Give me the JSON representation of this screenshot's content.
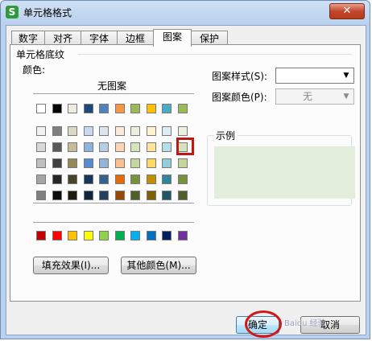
{
  "window": {
    "title": "单元格格式",
    "app_icon_letter": "S",
    "close_glyph": "✕"
  },
  "tabs": [
    {
      "label": "数字",
      "active": false
    },
    {
      "label": "对齐",
      "active": false
    },
    {
      "label": "字体",
      "active": false
    },
    {
      "label": "边框",
      "active": false
    },
    {
      "label": "图案",
      "active": true
    },
    {
      "label": "保护",
      "active": false
    }
  ],
  "shading": {
    "group_label": "单元格底纹",
    "color_label": "颜色:",
    "no_pattern_label": "无图案",
    "selected_color": "#e2eedb",
    "palette_rows": [
      [
        "#ffffff",
        "#000000",
        "#eeece1",
        "#1f497d",
        "#4f81bd",
        "#f79646",
        "#9bbb59",
        "#ffc000",
        "#4bacc6",
        "#9bbb59"
      ],
      [
        "#f2f2f2",
        "#7f7f7f",
        "#ddd9c3",
        "#c6d9f0",
        "#dbe5f1",
        "#fde9d9",
        "#ebf1dd",
        "#fff2cc",
        "#dbeef3",
        "#ebf1dd"
      ],
      [
        "#d8d8d8",
        "#595959",
        "#c4bd97",
        "#8db3e2",
        "#b8cce4",
        "#fbd5b5",
        "#d7e3bc",
        "#ffe599",
        "#b7dde8",
        "#d7e3bc"
      ],
      [
        "#bfbfbf",
        "#3f3f3f",
        "#938953",
        "#548dd4",
        "#95b3d7",
        "#fac08f",
        "#c3d69b",
        "#ffd966",
        "#92cddc",
        "#c3d69b"
      ],
      [
        "#a5a5a5",
        "#262626",
        "#494429",
        "#17365d",
        "#366092",
        "#e36c09",
        "#76923c",
        "#bf8f00",
        "#31859b",
        "#76923c"
      ],
      [
        "#7f7f7f",
        "#0c0c0c",
        "#1d1b10",
        "#0f243e",
        "#244061",
        "#974806",
        "#4f6128",
        "#7f6000",
        "#205867",
        "#4f6128"
      ]
    ],
    "standard_colors": [
      "#c00000",
      "#ff0000",
      "#ffc000",
      "#ffff00",
      "#92d050",
      "#00b050",
      "#00b0f0",
      "#0070c0",
      "#002060",
      "#7030a0"
    ],
    "fill_effects_button": "填充效果(I)...",
    "more_colors_button": "其他颜色(M)..."
  },
  "pattern": {
    "style_label": "图案样式(S):",
    "style_value": "",
    "color_label": "图案颜色(P):",
    "color_value": "无"
  },
  "preview": {
    "label": "示例"
  },
  "footer": {
    "ok_button": "确定",
    "cancel_button": "取消"
  },
  "watermark": "Baidu 经验"
}
